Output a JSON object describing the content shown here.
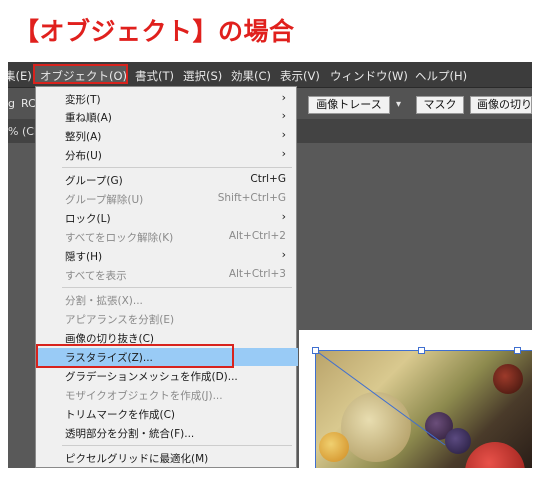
{
  "heading": "【オブジェクト】の場合",
  "menubar": {
    "items": [
      "集(E)",
      "オブジェクト(O)",
      "書式(T)",
      "選択(S)",
      "効果(C)",
      "表示(V)",
      "ウィンドウ(W)",
      "ヘルプ(H)"
    ]
  },
  "toolbar": {
    "left_fragment": "g",
    "left_fragment2": "RC",
    "buttons": [
      "画像トレース",
      "マスク",
      "画像の切り"
    ],
    "dropdown_icon": "chevron-down-icon"
  },
  "tabrow": {
    "fragment": "% (CM"
  },
  "menu": {
    "items": [
      {
        "label": "変形(T)",
        "shortcut": "",
        "submenu": true,
        "disabled": false
      },
      {
        "label": "重ね順(A)",
        "shortcut": "",
        "submenu": true,
        "disabled": false
      },
      {
        "label": "整列(A)",
        "shortcut": "",
        "submenu": true,
        "disabled": false
      },
      {
        "label": "分布(U)",
        "shortcut": "",
        "submenu": true,
        "disabled": false
      },
      {
        "label": "グループ(G)",
        "shortcut": "Ctrl+G",
        "submenu": false,
        "disabled": false
      },
      {
        "label": "グループ解除(U)",
        "shortcut": "Shift+Ctrl+G",
        "submenu": false,
        "disabled": true
      },
      {
        "label": "ロック(L)",
        "shortcut": "",
        "submenu": true,
        "disabled": false
      },
      {
        "label": "すべてをロック解除(K)",
        "shortcut": "Alt+Ctrl+2",
        "submenu": false,
        "disabled": true
      },
      {
        "label": "隠す(H)",
        "shortcut": "",
        "submenu": true,
        "disabled": false
      },
      {
        "label": "すべてを表示",
        "shortcut": "Alt+Ctrl+3",
        "submenu": false,
        "disabled": true
      },
      {
        "label": "分割・拡張(X)...",
        "shortcut": "",
        "submenu": false,
        "disabled": true
      },
      {
        "label": "アピアランスを分割(E)",
        "shortcut": "",
        "submenu": false,
        "disabled": true
      },
      {
        "label": "画像の切り抜き(C)",
        "shortcut": "",
        "submenu": false,
        "disabled": false
      },
      {
        "label": "ラスタライズ(Z)...",
        "shortcut": "",
        "submenu": false,
        "disabled": false,
        "highlighted": true
      },
      {
        "label": "グラデーションメッシュを作成(D)...",
        "shortcut": "",
        "submenu": false,
        "disabled": false
      },
      {
        "label": "モザイクオブジェクトを作成(J)...",
        "shortcut": "",
        "submenu": false,
        "disabled": true
      },
      {
        "label": "トリムマークを作成(C)",
        "shortcut": "",
        "submenu": false,
        "disabled": false
      },
      {
        "label": "透明部分を分割・統合(F)...",
        "shortcut": "",
        "submenu": false,
        "disabled": false
      },
      {
        "label": "ピクセルグリッドに最適化(M)",
        "shortcut": "",
        "submenu": false,
        "disabled": false
      }
    ],
    "submenu_arrow": "›"
  },
  "colors": {
    "accent_red": "#d8231d",
    "highlight_blue": "#99cbf6",
    "menubar_bg": "#3c3c3c"
  }
}
